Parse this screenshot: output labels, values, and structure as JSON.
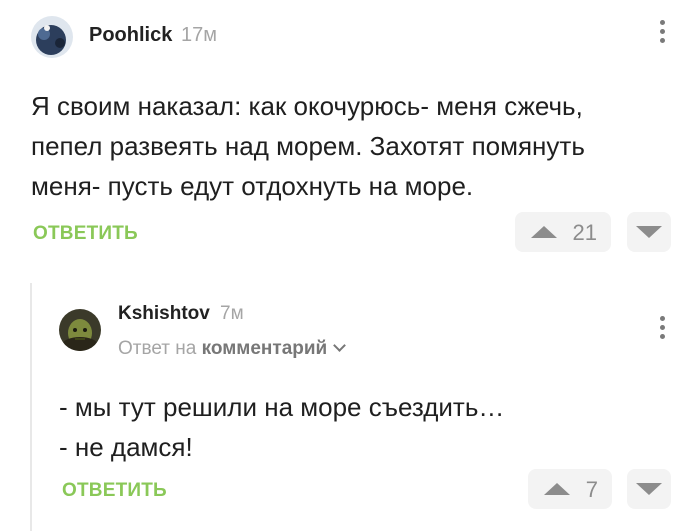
{
  "comments": [
    {
      "author": "Poohlick",
      "time": "17м",
      "lines": [
        "Я своим наказал: как окочурюсь- меня сжечь,",
        "пепел развеять над морем. Захотят помянуть",
        "меня- пусть едут отдохнуть на море."
      ],
      "reply_label": "ОТВЕТИТЬ",
      "rating": "21"
    },
    {
      "author": "Kshishtov",
      "time": "7м",
      "reply_to_prefix": "Ответ на",
      "reply_to_target": "комментарий",
      "lines": [
        "- мы тут решили на море съездить…",
        "- не дамся!"
      ],
      "reply_label": "ОТВЕТИТЬ",
      "rating": "7"
    }
  ],
  "colors": {
    "accent_green": "#8ac858",
    "muted": "#a5a5a5",
    "vote_bg": "#f3f3f3"
  },
  "icons": {
    "up": "triangle-up-icon",
    "down": "triangle-down-icon",
    "menu": "vertical-dots-icon",
    "chevron": "chevron-down-icon"
  }
}
